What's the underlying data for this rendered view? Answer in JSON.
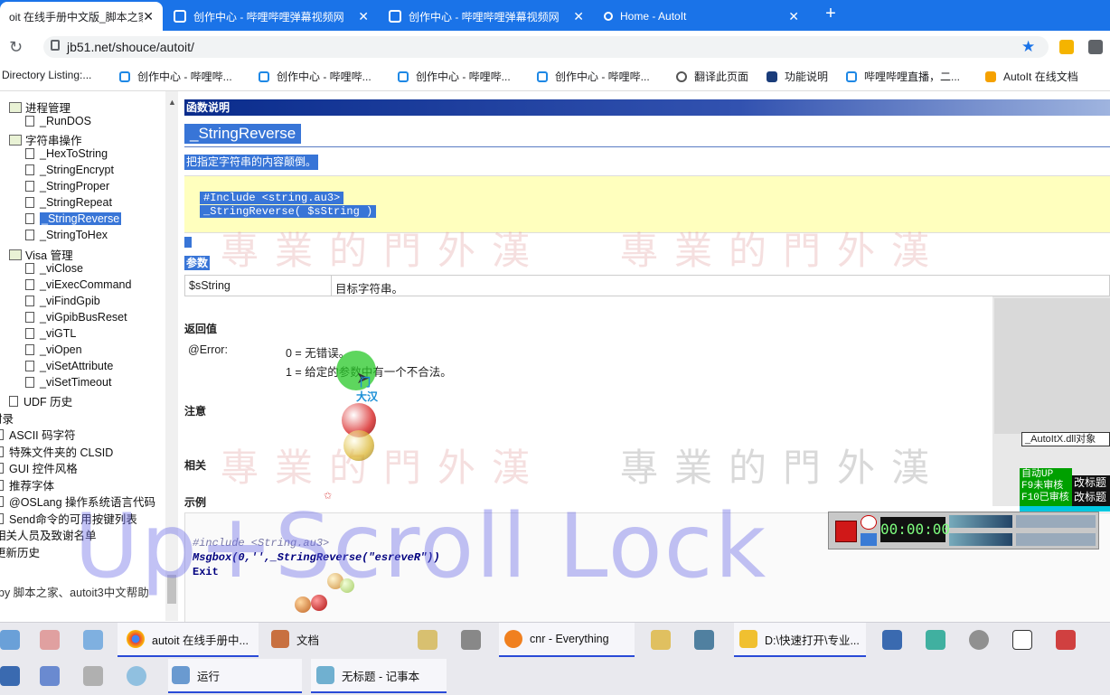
{
  "browser": {
    "tabs": [
      {
        "title": "oit 在线手册中文版_脚本之家",
        "active": true
      },
      {
        "title": "创作中心 - 哔哩哔哩弹幕视频网",
        "active": false
      },
      {
        "title": "创作中心 - 哔哩哔哩弹幕视频网",
        "active": false
      },
      {
        "title": "Home - AutoIt",
        "active": false
      }
    ],
    "url": "jb51.net/shouce/autoit/",
    "bookmarks": [
      "Directory Listing:...",
      "创作中心 - 哔哩哔...",
      "创作中心 - 哔哩哔...",
      "创作中心 - 哔哩哔...",
      "创作中心 - 哔哩哔...",
      "翻译此页面",
      "功能说明",
      "哔哩哔哩直播，二...",
      "AutoIt 在线文档"
    ],
    "accent_color": "#1a73e8"
  },
  "tree": {
    "items": [
      {
        "label": "进程管理",
        "type": "book"
      },
      {
        "label": "_RunDOS",
        "type": "doc"
      },
      {
        "label": "字符串操作",
        "type": "book"
      },
      {
        "label": "_HexToString",
        "type": "doc"
      },
      {
        "label": "_StringEncrypt",
        "type": "doc"
      },
      {
        "label": "_StringProper",
        "type": "doc"
      },
      {
        "label": "_StringRepeat",
        "type": "doc"
      },
      {
        "label": "_StringReverse",
        "type": "doc",
        "selected": true
      },
      {
        "label": "_StringToHex",
        "type": "doc"
      },
      {
        "label": "Visa 管理",
        "type": "book"
      },
      {
        "label": "_viClose",
        "type": "doc"
      },
      {
        "label": "_viExecCommand",
        "type": "doc"
      },
      {
        "label": "_viFindGpib",
        "type": "doc"
      },
      {
        "label": "_viGpibBusReset",
        "type": "doc"
      },
      {
        "label": "_viGTL",
        "type": "doc"
      },
      {
        "label": "_viOpen",
        "type": "doc"
      },
      {
        "label": "_viSetAttribute",
        "type": "doc"
      },
      {
        "label": "_viSetTimeout",
        "type": "doc"
      },
      {
        "label": "UDF 历史",
        "type": "doc"
      },
      {
        "label": "附录",
        "type": "book"
      },
      {
        "label": "ASCII 码字符",
        "type": "doc"
      },
      {
        "label": "特殊文件夹的 CLSID",
        "type": "doc"
      },
      {
        "label": "GUI 控件风格",
        "type": "doc"
      },
      {
        "label": "推荐字体",
        "type": "doc"
      },
      {
        "label": "@OSLang 操作系统语言代码",
        "type": "doc"
      },
      {
        "label": "Send命令的可用按键列表",
        "type": "doc"
      },
      {
        "label": "相关人员及致谢名单",
        "type": "doc"
      },
      {
        "label": "更新历史",
        "type": "doc"
      }
    ],
    "footer": "by 脚本之家、autoit3中文帮助"
  },
  "doc": {
    "header": "函数说明",
    "title": "_StringReverse",
    "description": "把指定字符串的内容颠倒。",
    "syntax": [
      "#Include <string.au3>",
      "_StringReverse( $sString )"
    ],
    "params_label": "参数",
    "params": [
      {
        "name": "$sString",
        "desc": "目标字符串。"
      }
    ],
    "return_label": "返回值",
    "return": {
      "key": "@Error:",
      "lines": [
        "0 = 无错误。",
        "1 = 给定的参数中有一个不合法。"
      ]
    },
    "notes_label": "注意",
    "related_label": "相关",
    "example_label": "示例",
    "example": [
      "#include <String.au3>",
      "Msgbox(0,'',_StringReverse(\"esreveR\"))",
      "Exit"
    ]
  },
  "overlay": {
    "watermark": "Up+Scroll Lock",
    "dll_label": "_AutoItX.dll对象",
    "status_green": [
      "自动UP",
      "F9未审核",
      "F10已审核"
    ],
    "status_black": [
      "改标题",
      "改标题"
    ],
    "timer": "00:00:00",
    "cursor_labels": [
      "门",
      "大汉"
    ]
  },
  "taskbar": {
    "row1": [
      {
        "label": "autoit 在线手册中...",
        "active": true
      },
      {
        "label": "文档",
        "active": false
      },
      {
        "label": "cnr - Everything",
        "active": true
      },
      {
        "label": "D:\\快速打开\\专业...",
        "active": true
      }
    ],
    "row2": [
      {
        "label": "运行",
        "active": true
      },
      {
        "label": "无标题 - 记事本",
        "active": true
      }
    ]
  }
}
